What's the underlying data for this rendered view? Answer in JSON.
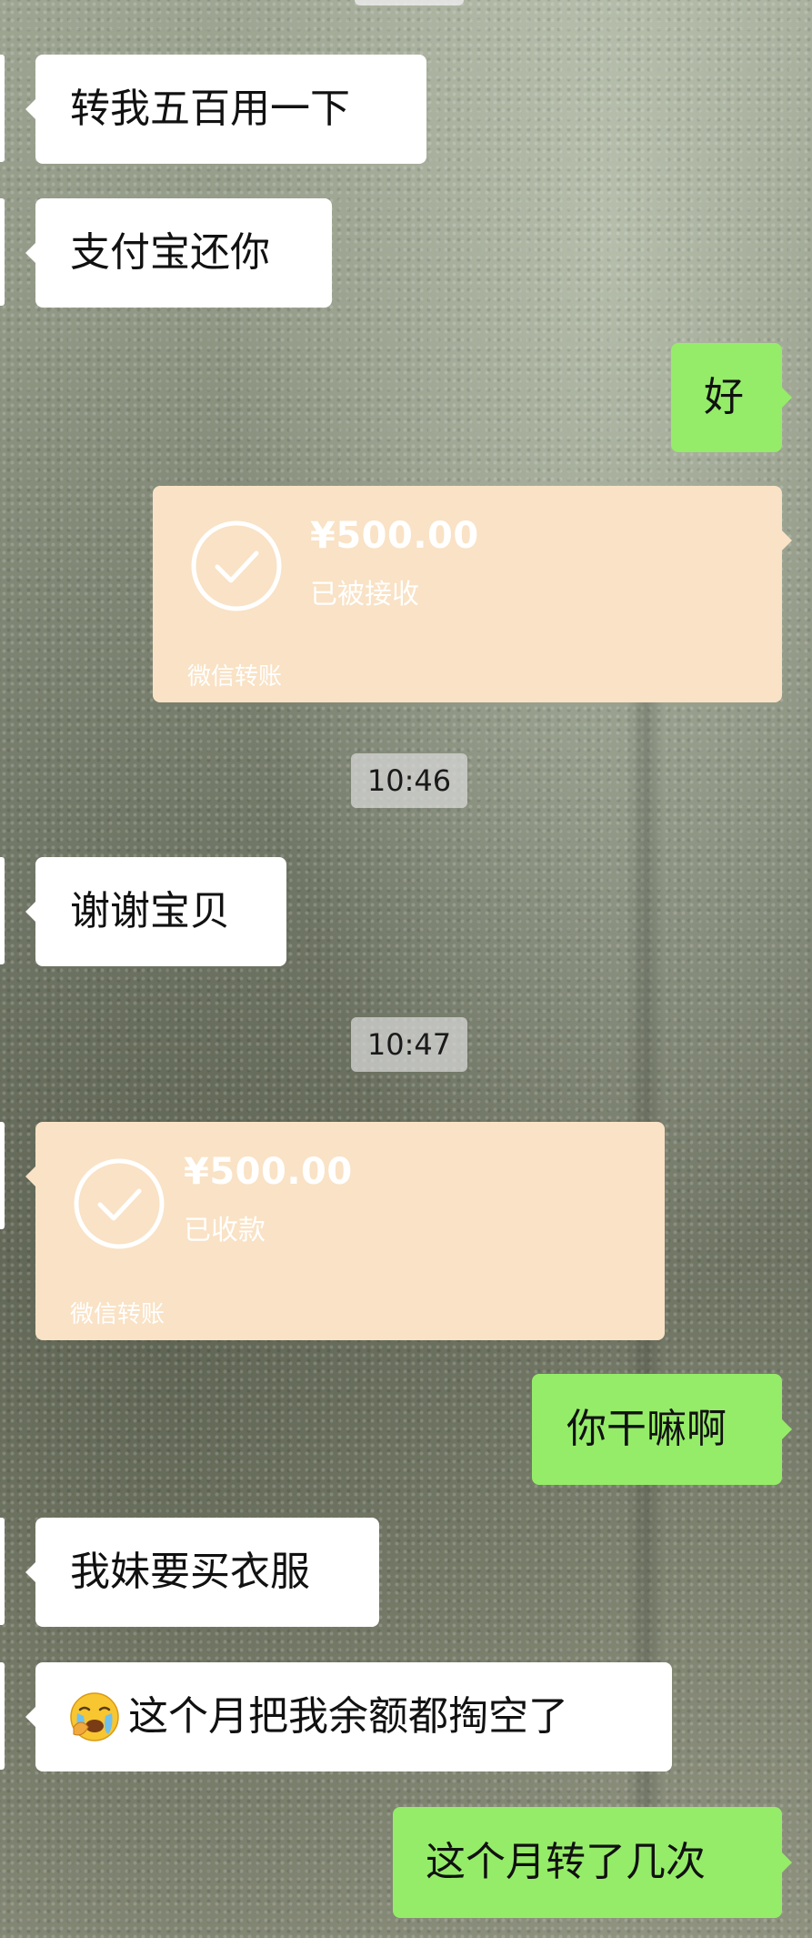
{
  "chat": {
    "messages": [
      {
        "side": "in",
        "type": "text",
        "text": "转我五百用一下"
      },
      {
        "side": "in",
        "type": "text",
        "text": "支付宝还你"
      },
      {
        "side": "out",
        "type": "text",
        "text": "好"
      },
      {
        "side": "out",
        "type": "transfer",
        "amount": "¥500.00",
        "status": "已被接收",
        "label": "微信转账"
      },
      {
        "type": "timestamp",
        "text": "10:46"
      },
      {
        "side": "in",
        "type": "text",
        "text": "谢谢宝贝"
      },
      {
        "type": "timestamp",
        "text": "10:47"
      },
      {
        "side": "in",
        "type": "transfer",
        "amount": "¥500.00",
        "status": "已收款",
        "label": "微信转账"
      },
      {
        "side": "out",
        "type": "text",
        "text": "你干嘛啊"
      },
      {
        "side": "in",
        "type": "text",
        "text": "我妹要买衣服"
      },
      {
        "side": "in",
        "type": "text",
        "emoji": "crying-face-icon",
        "text": "这个月把我余额都掏空了"
      },
      {
        "side": "out",
        "type": "text",
        "text": "这个月转了几次"
      }
    ]
  },
  "colors": {
    "incoming_bubble": "#ffffff",
    "outgoing_bubble": "#95ec69",
    "transfer_card": "#f9e2c5",
    "timestamp_chip": "#dadada"
  }
}
